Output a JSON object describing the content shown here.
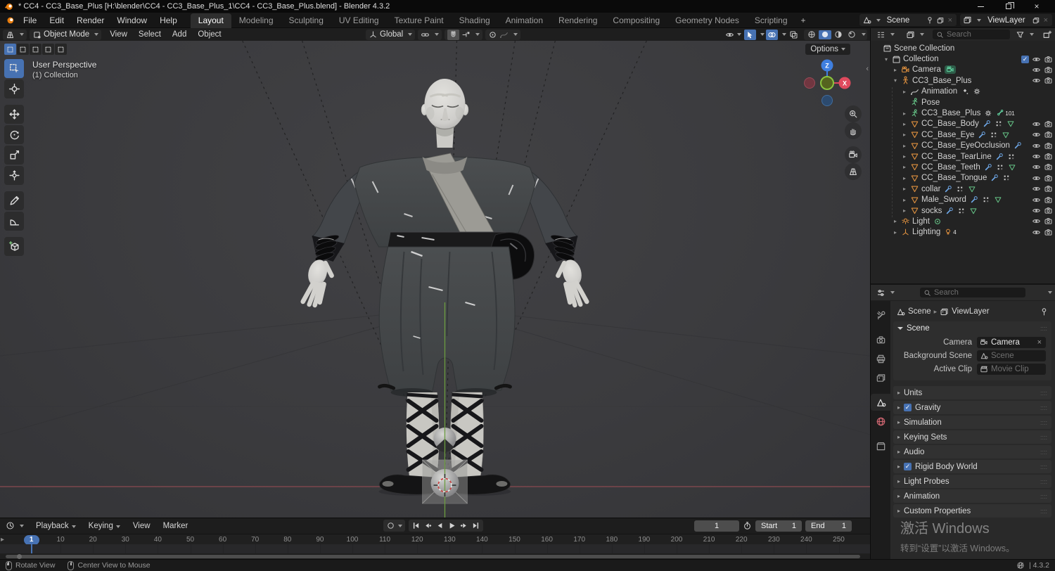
{
  "window": {
    "title": "* CC4 - CC3_Base_Plus [H:\\blender\\CC4 - CC3_Base_Plus_1\\CC4 - CC3_Base_Plus.blend] - Blender 4.3.2"
  },
  "menubar": {
    "menus": [
      "File",
      "Edit",
      "Render",
      "Window",
      "Help"
    ],
    "tabs": [
      "Layout",
      "Modeling",
      "Sculpting",
      "UV Editing",
      "Texture Paint",
      "Shading",
      "Animation",
      "Rendering",
      "Compositing",
      "Geometry Nodes",
      "Scripting"
    ],
    "active_tab": "Layout",
    "add_tab_label": "+",
    "scene_selector": {
      "label": "Scene"
    },
    "viewlayer_selector": {
      "label": "ViewLayer"
    }
  },
  "viewport_header": {
    "mode": "Object Mode",
    "menus": [
      "View",
      "Select",
      "Add",
      "Object"
    ],
    "orientation": "Global",
    "options_label": "Options"
  },
  "viewport": {
    "overlay_line1": "User Perspective",
    "overlay_line2": "(1) Collection",
    "gizmo": {
      "up": "Z",
      "right": "X"
    }
  },
  "toolbar": {
    "tools": [
      "select-box",
      "cursor",
      "move",
      "rotate",
      "scale",
      "transform",
      "annotate",
      "measure",
      "add-cube"
    ],
    "active": "select-box"
  },
  "select_modes": [
    "set",
    "extend",
    "subtract",
    "invert",
    "intersect"
  ],
  "outliner": {
    "search_placeholder": "Search",
    "rows": [
      {
        "label": "Scene Collection",
        "level": 0,
        "arrow": "none",
        "icon": "scol",
        "icon_color": "grey"
      },
      {
        "label": "Collection",
        "level": 1,
        "arrow": "open",
        "icon": "box",
        "icon_color": "grey",
        "check": true,
        "eye": true,
        "cam": true
      },
      {
        "label": "Camera",
        "level": 2,
        "arrow": "closed",
        "icon": "camobj",
        "icon_color": "orange",
        "chips": [
          {
            "icon": "camobj",
            "color": "mint",
            "bg": true
          }
        ],
        "eye": true,
        "cam": true
      },
      {
        "label": "CC3_Base_Plus",
        "level": 2,
        "arrow": "open",
        "icon": "person",
        "icon_color": "orange",
        "eye": true,
        "cam": true
      },
      {
        "label": "Animation",
        "level": 3,
        "arrow": "closed",
        "icon": "curve",
        "icon_color": "grey",
        "chips": [
          {
            "icon": "keyd",
            "color": "grey"
          },
          {
            "icon": "gear",
            "color": "grey"
          }
        ]
      },
      {
        "label": "Pose",
        "level": 3,
        "arrow": "none",
        "icon": "run",
        "icon_color": "green"
      },
      {
        "label": "CC3_Base_Plus",
        "level": 3,
        "arrow": "closed",
        "icon": "run",
        "icon_color": "green",
        "chips": [
          {
            "icon": "gear",
            "color": "grey"
          },
          {
            "icon": "bone",
            "color": "mint",
            "text": "101"
          }
        ]
      },
      {
        "label": "CC_Base_Body",
        "level": 3,
        "arrow": "closed",
        "icon": "tri",
        "icon_color": "orange",
        "chips": [
          {
            "icon": "wrench",
            "color": "blue"
          },
          {
            "icon": "dots",
            "color": "grey"
          },
          {
            "icon": "tri",
            "color": "green"
          }
        ],
        "eye": true,
        "cam": true
      },
      {
        "label": "CC_Base_Eye",
        "level": 3,
        "arrow": "closed",
        "icon": "tri",
        "icon_color": "orange",
        "chips": [
          {
            "icon": "wrench",
            "color": "blue"
          },
          {
            "icon": "dots",
            "color": "grey"
          },
          {
            "icon": "tri",
            "color": "green"
          }
        ],
        "eye": true,
        "cam": true
      },
      {
        "label": "CC_Base_EyeOcclusion",
        "level": 3,
        "arrow": "closed",
        "icon": "tri",
        "icon_color": "orange",
        "chips": [
          {
            "icon": "wrench",
            "color": "blue"
          }
        ],
        "eye": true,
        "cam": true
      },
      {
        "label": "CC_Base_TearLine",
        "level": 3,
        "arrow": "closed",
        "icon": "tri",
        "icon_color": "orange",
        "chips": [
          {
            "icon": "wrench",
            "color": "blue"
          },
          {
            "icon": "dots",
            "color": "grey"
          }
        ],
        "eye": true,
        "cam": true
      },
      {
        "label": "CC_Base_Teeth",
        "level": 3,
        "arrow": "closed",
        "icon": "tri",
        "icon_color": "orange",
        "chips": [
          {
            "icon": "wrench",
            "color": "blue"
          },
          {
            "icon": "dots",
            "color": "grey"
          },
          {
            "icon": "tri",
            "color": "green"
          }
        ],
        "eye": true,
        "cam": true
      },
      {
        "label": "CC_Base_Tongue",
        "level": 3,
        "arrow": "closed",
        "icon": "tri",
        "icon_color": "orange",
        "chips": [
          {
            "icon": "wrench",
            "color": "blue"
          },
          {
            "icon": "dots",
            "color": "grey"
          }
        ],
        "eye": true,
        "cam": true
      },
      {
        "label": "collar",
        "level": 3,
        "arrow": "closed",
        "icon": "tri",
        "icon_color": "orange",
        "chips": [
          {
            "icon": "wrench",
            "color": "blue"
          },
          {
            "icon": "dots",
            "color": "grey"
          },
          {
            "icon": "tri",
            "color": "green"
          }
        ],
        "eye": true,
        "cam": true
      },
      {
        "label": "Male_Sword",
        "level": 3,
        "arrow": "closed",
        "icon": "tri",
        "icon_color": "orange",
        "chips": [
          {
            "icon": "wrench",
            "color": "blue"
          },
          {
            "icon": "dots",
            "color": "grey"
          },
          {
            "icon": "tri",
            "color": "green"
          }
        ],
        "eye": true,
        "cam": true
      },
      {
        "label": "socks",
        "level": 3,
        "arrow": "closed",
        "icon": "tri",
        "icon_color": "orange",
        "chips": [
          {
            "icon": "wrench",
            "color": "blue"
          },
          {
            "icon": "dots",
            "color": "grey"
          },
          {
            "icon": "tri",
            "color": "green"
          }
        ],
        "eye": true,
        "cam": true
      },
      {
        "label": "Light",
        "level": 2,
        "arrow": "closed",
        "icon": "lightobj",
        "icon_color": "orange",
        "chips": [
          {
            "icon": "lightdata",
            "color": "green"
          }
        ],
        "eye": true,
        "cam": true
      },
      {
        "label": "Lighting",
        "level": 2,
        "arrow": "closed",
        "icon": "axis",
        "icon_color": "orange",
        "chips": [
          {
            "icon": "bulb",
            "color": "orange",
            "text": "4"
          }
        ],
        "eye": true,
        "cam": true
      }
    ]
  },
  "properties": {
    "search_placeholder": "Search",
    "tabs": [
      "tool",
      "render",
      "output",
      "view-layer",
      "scene",
      "world",
      "collection"
    ],
    "active_tab": "scene",
    "breadcrumb": {
      "scene": "Scene",
      "viewlayer": "ViewLayer"
    },
    "scene_panel": {
      "title": "Scene",
      "fields": [
        {
          "label": "Camera",
          "icon": "camobj",
          "value": "Camera",
          "clearable": true
        },
        {
          "label": "Background Scene",
          "icon": "cone",
          "placeholder": "Scene"
        },
        {
          "label": "Active Clip",
          "icon": "clap",
          "placeholder": "Movie Clip"
        }
      ]
    },
    "panels": [
      {
        "label": "Units"
      },
      {
        "label": "Gravity",
        "check": true
      },
      {
        "label": "Simulation"
      },
      {
        "label": "Keying Sets"
      },
      {
        "label": "Audio"
      },
      {
        "label": "Rigid Body World",
        "check": true
      },
      {
        "label": "Light Probes"
      },
      {
        "label": "Animation"
      },
      {
        "label": "Custom Properties"
      }
    ]
  },
  "timeline": {
    "menus": [
      {
        "label": "Playback",
        "caret": true
      },
      {
        "label": "Keying",
        "caret": true
      },
      {
        "label": "View"
      },
      {
        "label": "Marker"
      }
    ],
    "playback_buttons": [
      "jump-start",
      "prev-keyframe",
      "play-reverse",
      "play",
      "next-keyframe",
      "jump-end"
    ],
    "current_frame": "1",
    "start_label": "Start",
    "start_value": "1",
    "end_label": "End",
    "end_value": "1",
    "playhead_frame": 1,
    "frame_ticks": [
      10,
      20,
      30,
      40,
      50,
      60,
      70,
      80,
      90,
      100,
      110,
      120,
      130,
      140,
      150,
      160,
      170,
      180,
      190,
      200,
      210,
      220,
      230,
      240,
      250
    ]
  },
  "status_bar": {
    "items": [
      {
        "label": "Rotate View"
      },
      {
        "label": "Center View to Mouse"
      }
    ],
    "version": "| 4.3.2"
  },
  "watermark": {
    "line1": "激活 Windows",
    "line2": "转到“设置”以激活 Windows。"
  },
  "colors": {
    "accent": "#4772b3",
    "object_orange": "#e0913f",
    "data_green": "#67c789",
    "modifier_blue": "#6fa8e8",
    "axis_x": "#e04a5e",
    "axis_z": "#3f7fe0",
    "axis_y_ball": "#8bc53f"
  }
}
